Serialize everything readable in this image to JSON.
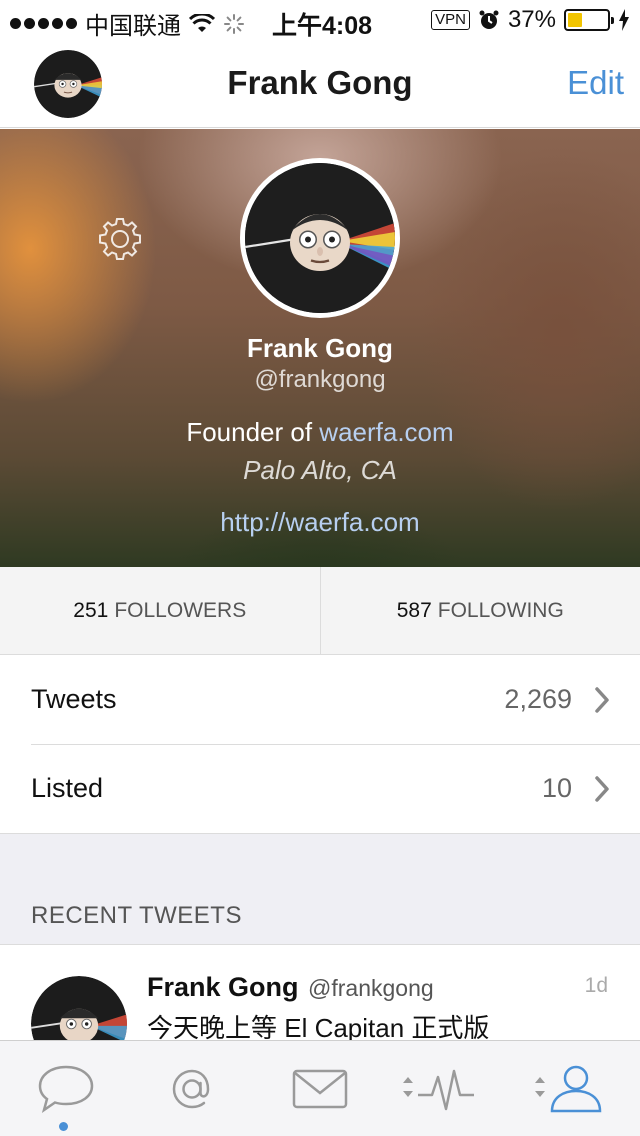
{
  "status_bar": {
    "carrier": "中国联通",
    "time": "上午4:08",
    "vpn": "VPN",
    "battery": "37%",
    "battery_level": 0.37
  },
  "nav": {
    "title": "Frank Gong",
    "edit_label": "Edit"
  },
  "profile": {
    "name": "Frank Gong",
    "handle": "@frankgong",
    "bio_prefix": "Founder of",
    "bio_link": "waerfa.com",
    "location": "Palo Alto, CA",
    "url": "http://waerfa.com"
  },
  "stats": {
    "followers_count": "251",
    "followers_label": "FOLLOWERS",
    "following_count": "587",
    "following_label": "FOLLOWING"
  },
  "rows": {
    "tweets_label": "Tweets",
    "tweets_count": "2,269",
    "listed_label": "Listed",
    "listed_count": "10"
  },
  "recent": {
    "section_title": "RECENT TWEETS",
    "tweet": {
      "name": "Frank Gong",
      "handle": "@frankgong",
      "time": "1d",
      "text": "今天晚上等 El Capitan 正式版"
    }
  },
  "tabs": [
    {
      "icon": "chat-bubble-icon",
      "active": true
    },
    {
      "icon": "at-mention-icon",
      "active": false
    },
    {
      "icon": "envelope-icon",
      "active": false
    },
    {
      "icon": "activity-icon",
      "active": false
    },
    {
      "icon": "profile-icon",
      "active": false
    }
  ],
  "colors": {
    "accent": "#4a90d6",
    "battery": "#f2c500",
    "link": "#b7cff0"
  }
}
